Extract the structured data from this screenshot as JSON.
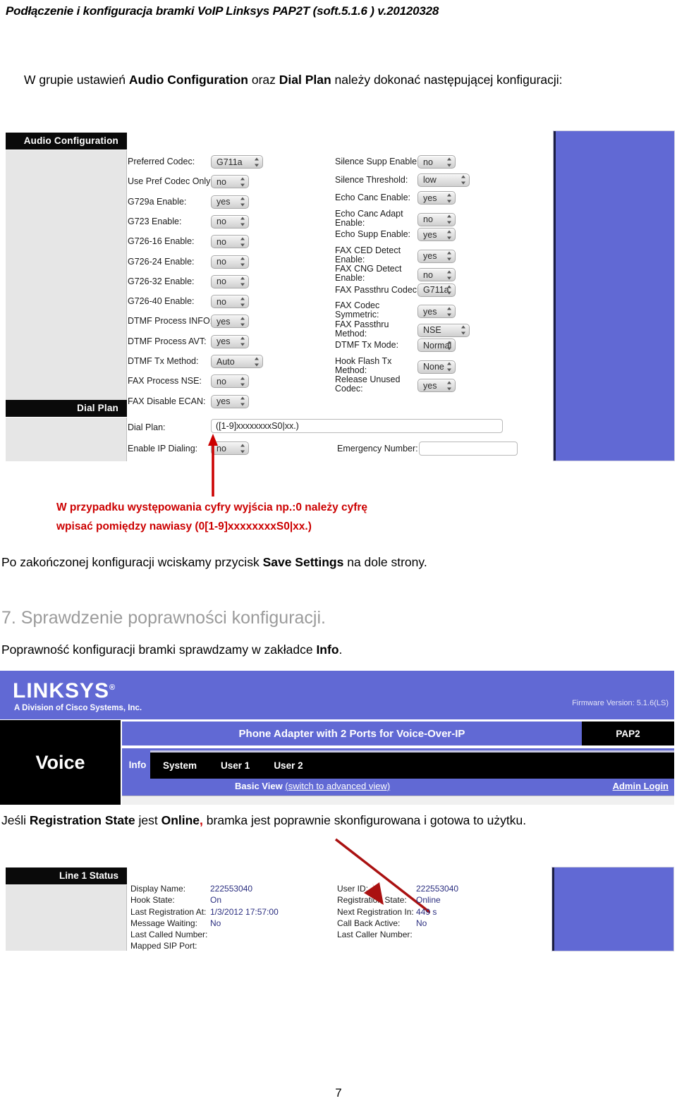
{
  "document": {
    "running_header": "Podłączenie i konfiguracja bramki VoIP Linksys PAP2T (soft.5.1.6 ) v.20120328",
    "page_number": "7"
  },
  "paragraphs": {
    "intro_1": "W grupie ustawień ",
    "intro_b1": "Audio Configuration",
    "intro_2": " oraz ",
    "intro_b2": "Dial Plan",
    "intro_3": " należy dokonać następującej konfiguracji:",
    "red_note_line1": "W przypadku występowania cyfry wyjścia np.:0 należy cyfrę",
    "red_note_line2": "wpisać pomiędzy nawiasy (0[1-9]xxxxxxxxS0|xx.)",
    "save_1": "Po zakończonej konfiguracji wciskamy przycisk ",
    "save_b": "Save Settings",
    "save_2": " na dole strony.",
    "section_heading": "7. Sprawdzenie poprawności konfiguracji.",
    "info_1": "Poprawność konfiguracji bramki sprawdzamy w zakładce ",
    "info_b": "Info",
    "info_2": ".",
    "final_1": "Jeśli ",
    "final_b1": "Registration State",
    "final_2": " jest ",
    "final_b2": "Online",
    "final_comma": ",",
    "final_3": " bramka jest poprawnie skonfigurowana i gotowa to użytku."
  },
  "audio_config": {
    "section_title": "Audio Configuration",
    "left_fields": [
      {
        "label": "Preferred Codec:",
        "value": "G711a",
        "type": "select",
        "wide": true
      },
      {
        "label": "Use Pref Codec Only:",
        "value": "no",
        "type": "select"
      },
      {
        "label": "G729a Enable:",
        "value": "yes",
        "type": "select"
      },
      {
        "label": "G723 Enable:",
        "value": "no",
        "type": "select"
      },
      {
        "label": "G726-16 Enable:",
        "value": "no",
        "type": "select"
      },
      {
        "label": "G726-24 Enable:",
        "value": "no",
        "type": "select"
      },
      {
        "label": "G726-32 Enable:",
        "value": "no",
        "type": "select"
      },
      {
        "label": "G726-40 Enable:",
        "value": "no",
        "type": "select"
      },
      {
        "label": "DTMF Process INFO:",
        "value": "yes",
        "type": "select"
      },
      {
        "label": "DTMF Process AVT:",
        "value": "yes",
        "type": "select"
      },
      {
        "label": "DTMF Tx Method:",
        "value": "Auto",
        "type": "select",
        "wide": true
      },
      {
        "label": "FAX Process NSE:",
        "value": "no",
        "type": "select"
      },
      {
        "label": "FAX Disable ECAN:",
        "value": "yes",
        "type": "select"
      }
    ],
    "right_fields": [
      {
        "label": "Silence Supp Enable:",
        "value": "no",
        "type": "select"
      },
      {
        "label": "Silence Threshold:",
        "value": "low",
        "type": "select",
        "wide": true
      },
      {
        "label": "Echo Canc Enable:",
        "value": "yes",
        "type": "select"
      },
      {
        "label": "Echo Canc Adapt\nEnable:",
        "value": "no",
        "type": "select"
      },
      {
        "label": "Echo Supp Enable:",
        "value": "yes",
        "type": "select"
      },
      {
        "label": "FAX CED Detect\nEnable:",
        "value": "yes",
        "type": "select"
      },
      {
        "label": "FAX CNG Detect\nEnable:",
        "value": "no",
        "type": "select"
      },
      {
        "label": "FAX Passthru Codec:",
        "value": "G711a",
        "type": "select"
      },
      {
        "label": "FAX Codec\nSymmetric:",
        "value": "yes",
        "type": "select"
      },
      {
        "label": "FAX Passthru\nMethod:",
        "value": "NSE",
        "type": "select",
        "wide": true
      },
      {
        "label": "DTMF Tx Mode:",
        "value": "Normal",
        "type": "select"
      },
      {
        "label": "Hook Flash Tx\nMethod:",
        "value": "None",
        "type": "select"
      },
      {
        "label": "Release Unused\nCodec:",
        "value": "yes",
        "type": "select"
      }
    ]
  },
  "dial_plan": {
    "section_title": "Dial Plan",
    "dial_plan_label": "Dial Plan:",
    "dial_plan_value": "([1-9]xxxxxxxxS0|xx.)",
    "enable_ip_label": "Enable IP Dialing:",
    "enable_ip_value": "no",
    "emergency_label": "Emergency Number:",
    "emergency_value": ""
  },
  "linksys": {
    "brand": "LINKSYS",
    "brand_mark": "®",
    "tagline": "A Division of Cisco Systems, Inc.",
    "firmware": "Firmware Version: 5.1.6(LS)",
    "voice_label": "Voice",
    "product_name": "Phone Adapter with 2 Ports for Voice-Over-IP",
    "model": "PAP2",
    "tabs": [
      "Info",
      "System",
      "User 1",
      "User 2"
    ],
    "basic_view": "Basic View",
    "switch_link": "(switch to advanced view)",
    "admin_login": "Admin Login"
  },
  "line_status": {
    "section_title": "Line 1 Status",
    "left": [
      {
        "label": "Display Name:",
        "value": "222553040"
      },
      {
        "label": "Hook State:",
        "value": "On"
      },
      {
        "label": "Last Registration At:",
        "value": "1/3/2012 17:57:00"
      },
      {
        "label": "Message Waiting:",
        "value": "No"
      },
      {
        "label": "Last Called Number:",
        "value": ""
      },
      {
        "label": "Mapped SIP Port:",
        "value": ""
      }
    ],
    "right": [
      {
        "label": "User ID:",
        "value": "222553040"
      },
      {
        "label": "Registration State:",
        "value": "Online"
      },
      {
        "label": "Next Registration In:",
        "value": "449 s"
      },
      {
        "label": "Call Back Active:",
        "value": "No"
      },
      {
        "label": "Last Caller Number:",
        "value": ""
      }
    ]
  },
  "colors": {
    "linksys_purple": "#6169d4",
    "annotation_red": "#cc0000",
    "value_blue": "#2b2f80",
    "heading_gray": "#9b9b9b"
  }
}
